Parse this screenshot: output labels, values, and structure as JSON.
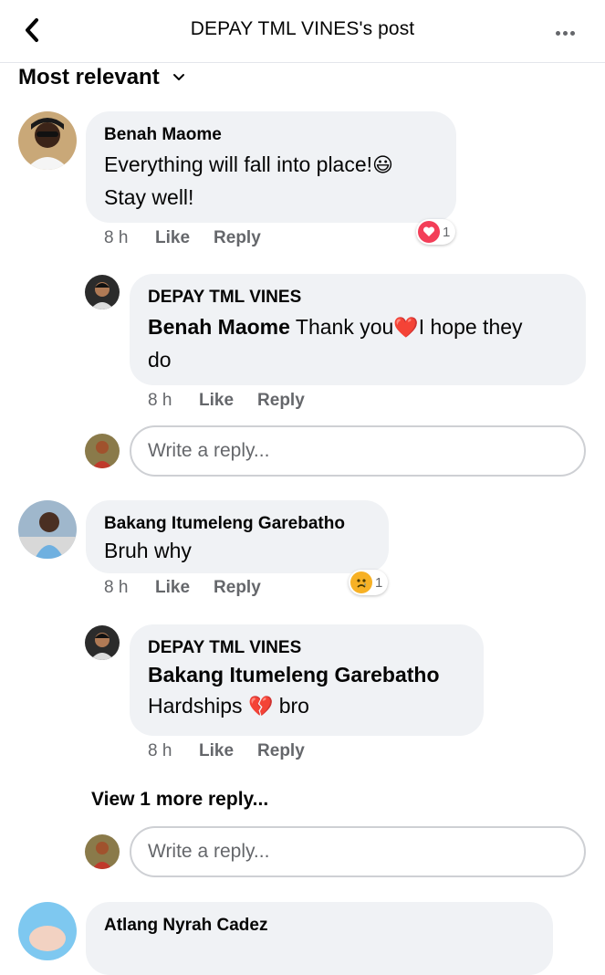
{
  "header": {
    "title": "DEPAY TML VINES's post",
    "back_icon": "back-chevron-icon",
    "more_icon": "more-dots-icon"
  },
  "sort": {
    "label": "Most relevant",
    "icon": "chevron-down-icon"
  },
  "comments": [
    {
      "author": "Benah Maome",
      "text_line1": "Everything will fall into place!",
      "text_emoji": "😃",
      "text_line2": "Stay well!",
      "time": "8 h",
      "like": "Like",
      "reply": "Reply",
      "reaction": {
        "icon": "love-reaction-icon",
        "count": "1"
      },
      "replies": [
        {
          "author": "DEPAY TML VINES",
          "mention": "Benah Maome",
          "text_before": " Thank you",
          "emoji": "❤️",
          "text_after": "I hope they",
          "text_line2": "do",
          "time": "8 h",
          "like": "Like",
          "reply": "Reply"
        }
      ],
      "reply_placeholder": "Write a reply..."
    },
    {
      "author": "Bakang Itumeleng Garebatho",
      "text": "Bruh why",
      "time": "8 h",
      "like": "Like",
      "reply": "Reply",
      "reaction": {
        "icon": "sad-reaction-icon",
        "count": "1"
      },
      "replies": [
        {
          "author": "DEPAY TML VINES",
          "mention": "Bakang Itumeleng Garebatho",
          "text_before": "Hardships ",
          "emoji": "💔",
          "text_after": " bro",
          "time": "8 h",
          "like": "Like",
          "reply": "Reply"
        }
      ],
      "view_more": "View 1 more reply...",
      "reply_placeholder": "Write a reply..."
    },
    {
      "author": "Atlang Nyrah Cadez"
    }
  ],
  "colors": {
    "bubble": "#f0f2f5",
    "meta": "#65676b",
    "love": "#f33e58",
    "border": "#ced0d4"
  }
}
